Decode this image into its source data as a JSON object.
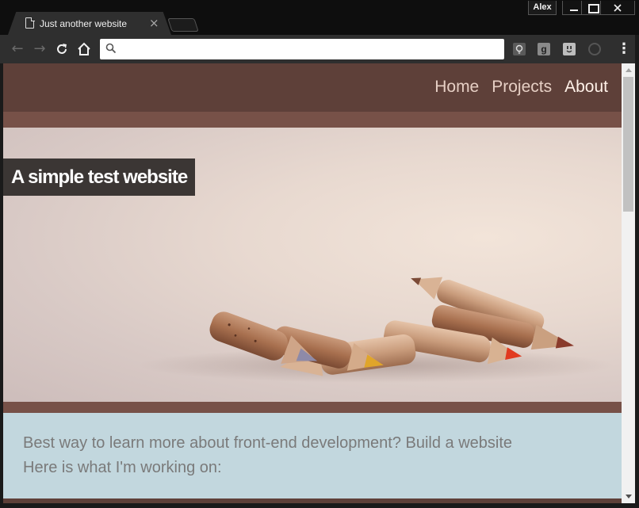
{
  "browser": {
    "tab_title": "Just another website",
    "tab_close": "×",
    "profile_name": "Alex",
    "address_value": "",
    "ext_g_label": "g",
    "nav": {
      "back": "←",
      "forward": "→",
      "reload": "⟳",
      "home": "⌂",
      "menu": "⋮"
    }
  },
  "site": {
    "nav_links": [
      {
        "label": "Home"
      },
      {
        "label": "Projects"
      },
      {
        "label": "About"
      }
    ],
    "hero_title": "A simple test website",
    "intro_line_1": "Best way to learn more about front-end development? Build a website",
    "intro_line_2": "Here is what I'm working on:"
  },
  "colors": {
    "nav_bg": "#5e4039",
    "strip_bg": "#775148",
    "hero_title_bg": "#3b3634",
    "intro_bg": "#c2d7de",
    "intro_text": "#7a7a7a"
  },
  "icons": {
    "tab_favicon": "page-icon",
    "search": "magnifier-icon",
    "ext_1": "lightbulb-icon",
    "ext_2": "g-letter-icon",
    "ext_3": "socket-icon",
    "ext_4": "sync-ring-icon"
  }
}
